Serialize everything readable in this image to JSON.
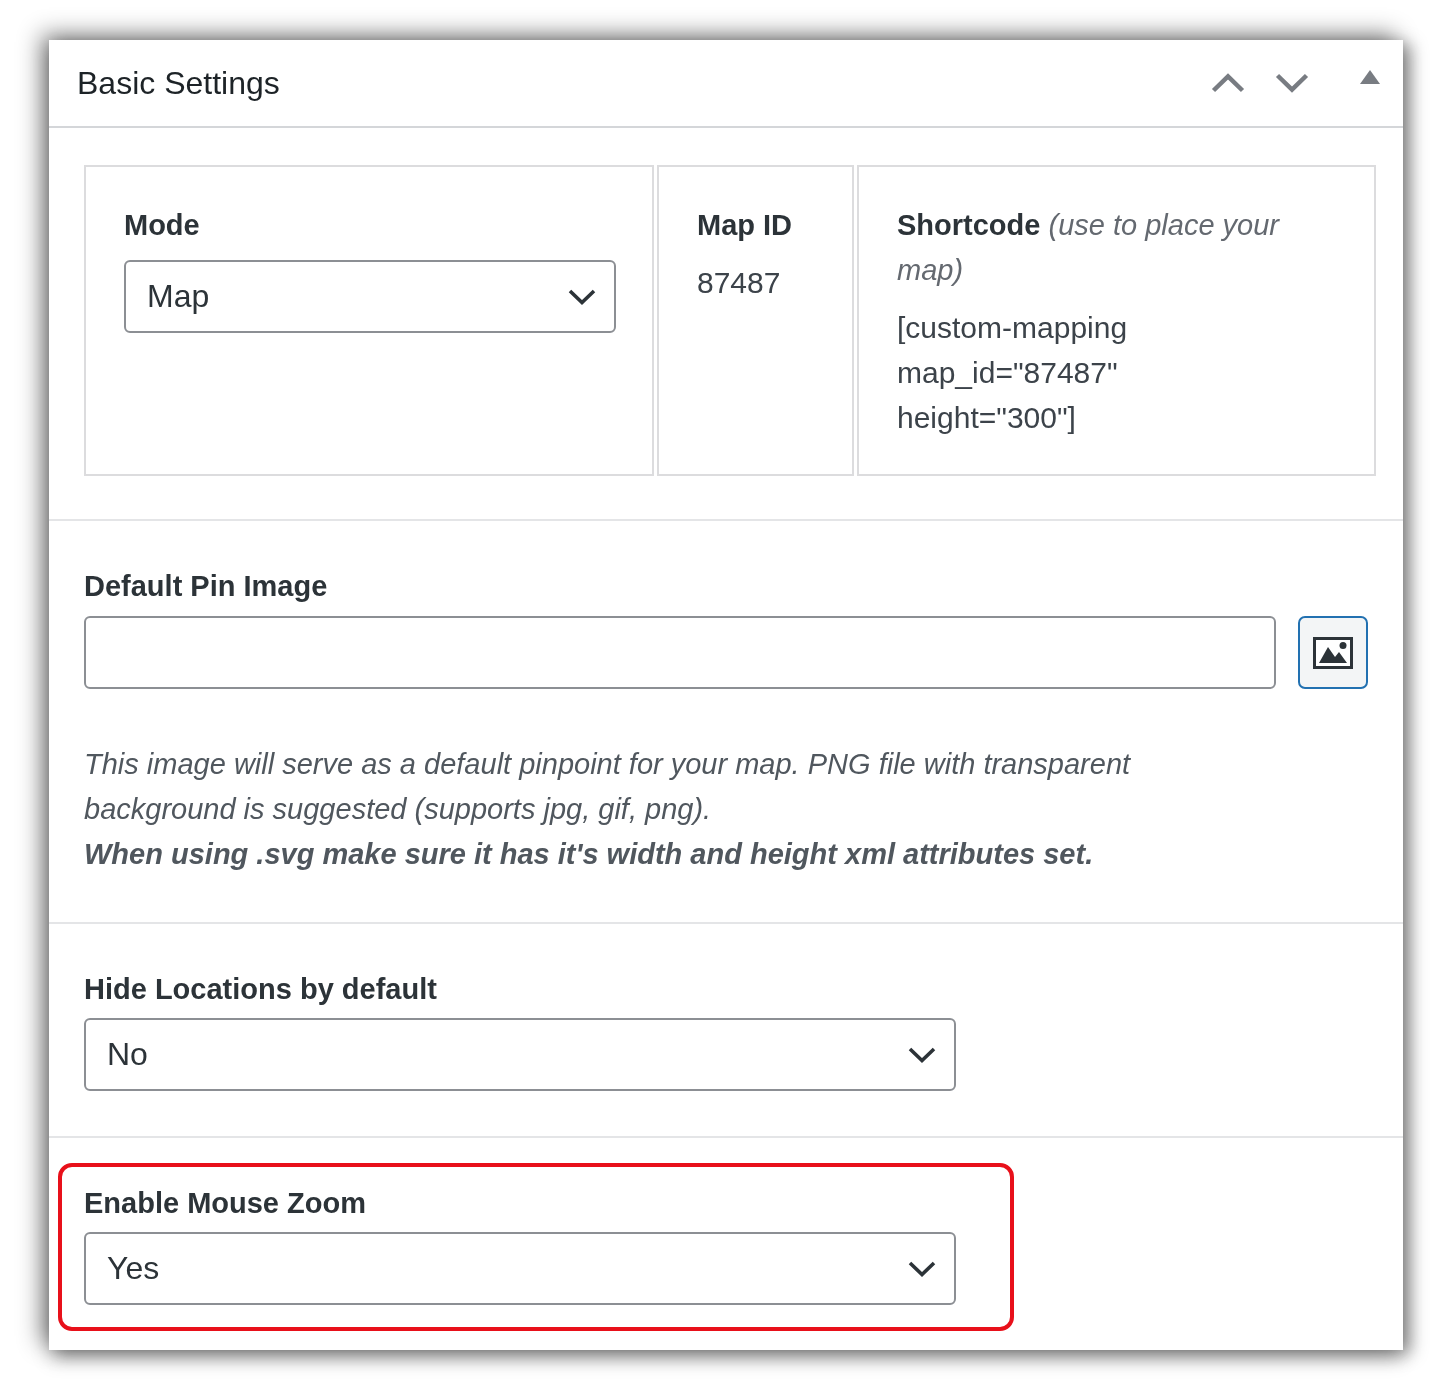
{
  "panel": {
    "title": "Basic Settings"
  },
  "summary": [
    {
      "kind": "select",
      "label": "Mode",
      "value": "Map"
    },
    {
      "kind": "text",
      "label": "Map ID",
      "value": "87487"
    },
    {
      "kind": "shortcode",
      "label": "**Shortcode** *(use to place your map)*",
      "value": "[custom-mapping map_id=\"87487\" height=\"300\"]"
    }
  ],
  "fields": [
    {
      "kind": "image",
      "label": "Default Pin Image",
      "help": "This image will serve as a default pinpoint for your map. PNG file with transparent background is suggested (supports jpg, gif, png).",
      "note": "When using .svg make sure it has it's width and height xml attributes set.",
      "highlighted": false
    },
    {
      "kind": "select",
      "label": "Hide Locations by default",
      "value": "No",
      "highlighted": false
    },
    {
      "kind": "select",
      "label": "Enable Mouse Zoom",
      "value": "Yes",
      "highlighted": true
    }
  ]
}
